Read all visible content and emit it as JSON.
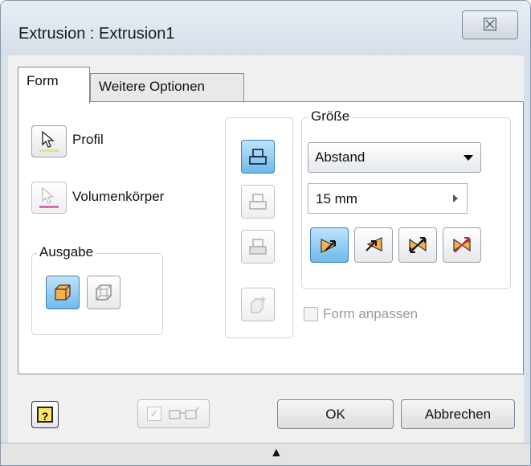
{
  "window": {
    "title": "Extrusion : Extrusion1",
    "close_glyph": "☒"
  },
  "tabs": [
    {
      "label": "Form",
      "active": true
    },
    {
      "label": "Weitere Optionen",
      "active": false
    }
  ],
  "profile": {
    "label": "Profil"
  },
  "solid": {
    "label": "Volumenkörper"
  },
  "output": {
    "legend": "Ausgabe",
    "buttons": [
      "solid-output-icon",
      "surface-output-icon"
    ],
    "selected": 0
  },
  "operations": [
    "join-icon",
    "cut-icon",
    "intersect-icon",
    "new-solid-icon"
  ],
  "size": {
    "legend": "Größe",
    "extent_selected": "Abstand",
    "distance_value": "15 mm",
    "direction_buttons": [
      "direction-1-icon",
      "direction-2-icon",
      "symmetric-icon",
      "asymmetric-icon"
    ],
    "direction_selected": 0
  },
  "match_shape": {
    "label": "Form anpassen",
    "checked": false,
    "enabled": false
  },
  "footer": {
    "help_label": "?",
    "preview_check_glyph": "✓",
    "ok_label": "OK",
    "cancel_label": "Abbrechen",
    "collapse_glyph": "▲"
  },
  "colors": {
    "accent_blue": "#6fb9ea",
    "profile_underline": "#e7e27a",
    "solid_underline": "#c21d93",
    "orange_face": "#f5b04a"
  }
}
